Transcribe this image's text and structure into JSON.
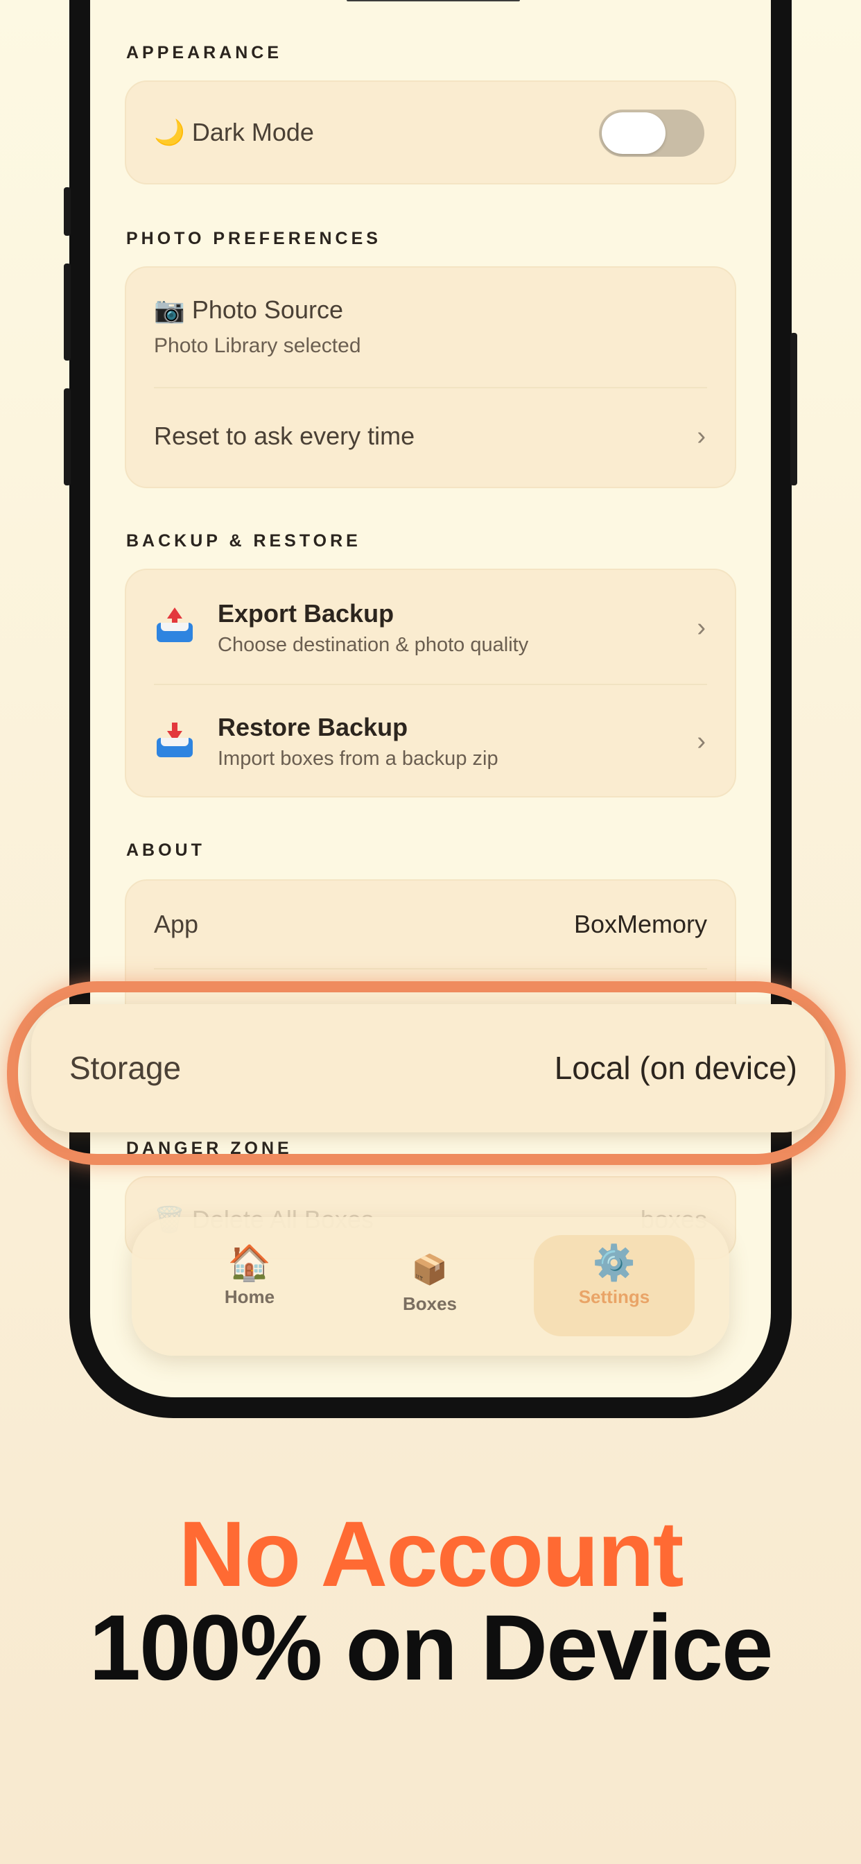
{
  "colors": {
    "accent_orange": "#ff6a33",
    "callout_ring": "#ef8b5e",
    "card_bg": "#faecd0",
    "page_bg": "#fdf8e2"
  },
  "sections": {
    "appearance": {
      "title": "APPEARANCE",
      "dark_mode": {
        "icon": "🌙",
        "label": "Dark Mode",
        "enabled": false
      }
    },
    "photo_preferences": {
      "title": "PHOTO PREFERENCES",
      "photo_source": {
        "icon": "📷",
        "label": "Photo Source",
        "sub": "Photo Library selected"
      },
      "reset": {
        "label": "Reset to ask every time"
      }
    },
    "backup_restore": {
      "title": "BACKUP & RESTORE",
      "export": {
        "icon": "outbox-tray-icon",
        "title": "Export Backup",
        "sub": "Choose destination & photo quality"
      },
      "restore": {
        "icon": "inbox-tray-icon",
        "title": "Restore Backup",
        "sub": "Import boxes from a backup zip"
      }
    },
    "about": {
      "title": "ABOUT",
      "app_label": "App",
      "app_value": "BoxMemory"
    },
    "danger_zone": {
      "title": "DANGER ZONE",
      "delete_label": "Delete All Boxes",
      "delete_value": "boxes"
    }
  },
  "callout": {
    "label": "Storage",
    "value": "Local (on device)"
  },
  "nav": {
    "items": [
      {
        "emoji": "🏠",
        "label": "Home"
      },
      {
        "emoji": "📦",
        "label": "Boxes"
      },
      {
        "emoji": "⚙️",
        "label": "Settings",
        "active": true
      }
    ]
  },
  "marketing": {
    "headline_1": "No Account",
    "headline_2": "100% on Device"
  }
}
